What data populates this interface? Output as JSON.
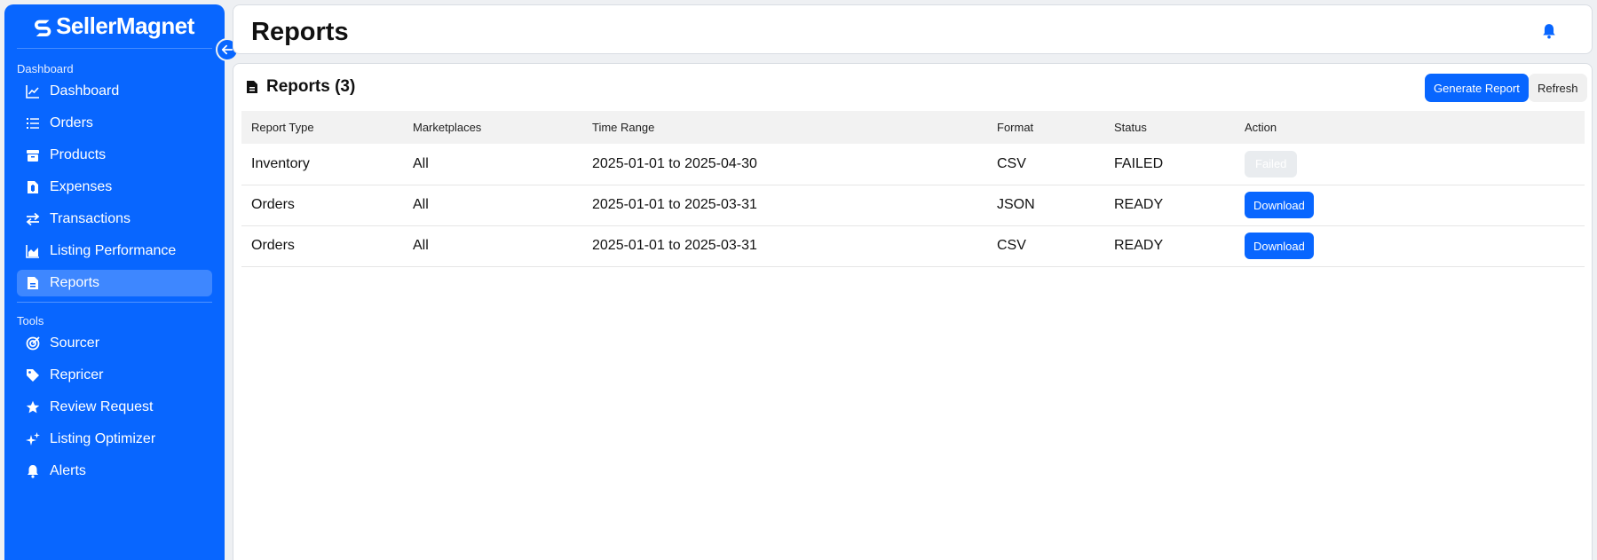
{
  "brand": {
    "name": "SellerMagnet",
    "color": "#0866ff"
  },
  "sidebar": {
    "sections": [
      {
        "label": "Dashboard"
      },
      {
        "label": "Tools"
      }
    ],
    "items": [
      {
        "label": "Dashboard",
        "icon": "line-chart-icon"
      },
      {
        "label": "Orders",
        "icon": "list-icon"
      },
      {
        "label": "Products",
        "icon": "box-icon"
      },
      {
        "label": "Expenses",
        "icon": "receipt-icon"
      },
      {
        "label": "Transactions",
        "icon": "swap-arrows-icon"
      },
      {
        "label": "Listing Performance",
        "icon": "area-chart-icon"
      },
      {
        "label": "Reports",
        "icon": "file-icon",
        "active": true
      },
      {
        "label": "Sourcer",
        "icon": "target-icon"
      },
      {
        "label": "Repricer",
        "icon": "tag-icon"
      },
      {
        "label": "Review Request",
        "icon": "star-icon"
      },
      {
        "label": "Listing Optimizer",
        "icon": "sparkles-icon"
      },
      {
        "label": "Alerts",
        "icon": "bell-icon"
      }
    ]
  },
  "header": {
    "title": "Reports"
  },
  "card": {
    "title": "Reports (3)",
    "generate_label": "Generate Report",
    "refresh_label": "Refresh"
  },
  "table": {
    "columns": [
      "Report Type",
      "Marketplaces",
      "Time Range",
      "Format",
      "Status",
      "Action"
    ],
    "rows": [
      {
        "type": "Inventory",
        "marketplaces": "All",
        "range": "2025-01-01 to 2025-04-30",
        "format": "CSV",
        "status": "FAILED",
        "action": "Failed"
      },
      {
        "type": "Orders",
        "marketplaces": "All",
        "range": "2025-01-01 to 2025-03-31",
        "format": "JSON",
        "status": "READY",
        "action": "Download"
      },
      {
        "type": "Orders",
        "marketplaces": "All",
        "range": "2025-01-01 to 2025-03-31",
        "format": "CSV",
        "status": "READY",
        "action": "Download"
      }
    ]
  }
}
